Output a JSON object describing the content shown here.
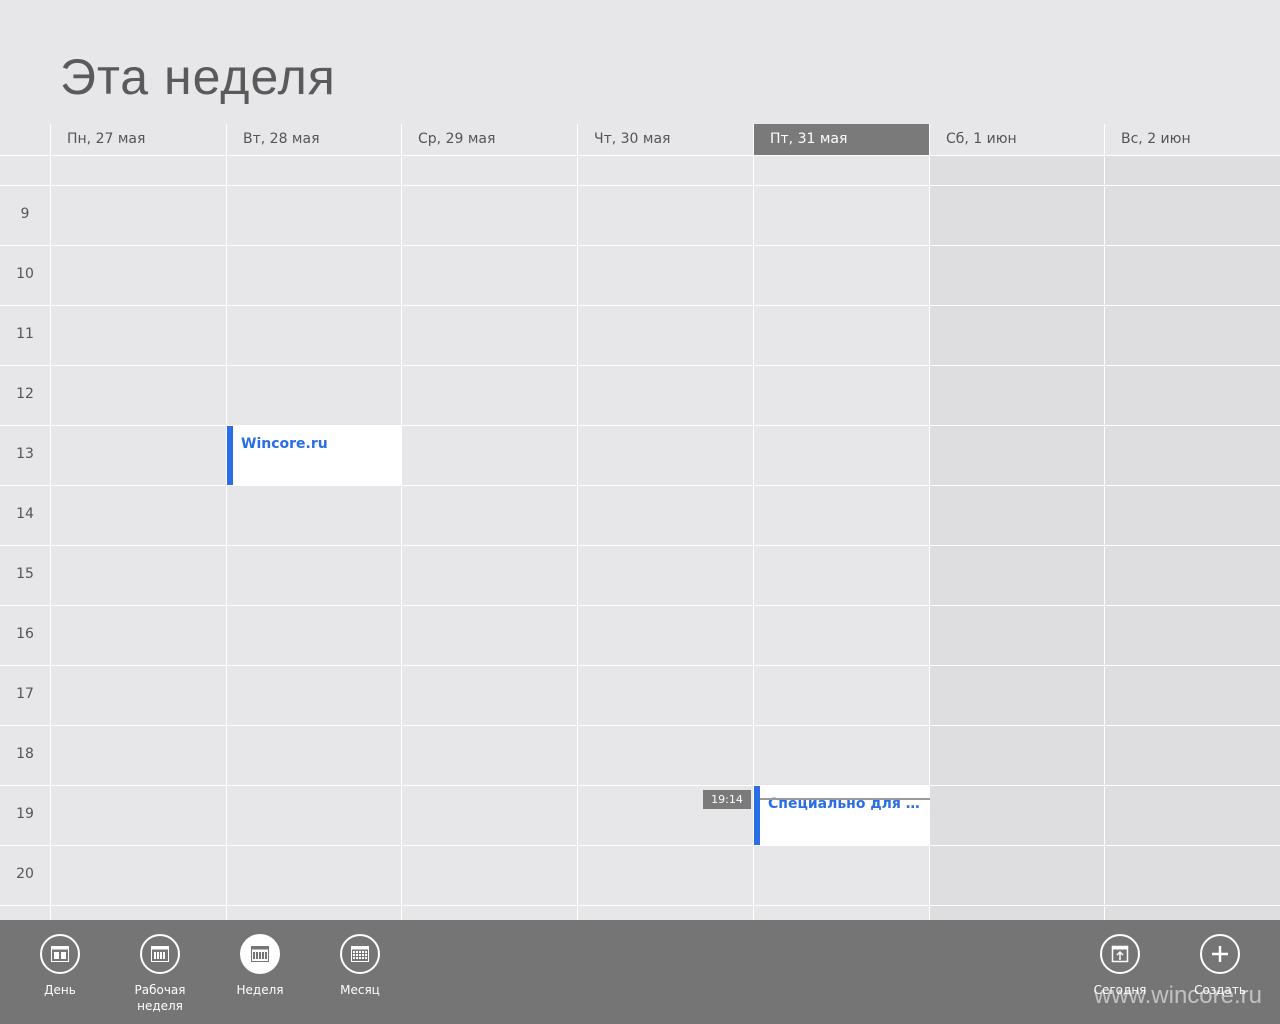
{
  "page": {
    "title": "Эта неделя"
  },
  "days": [
    {
      "label": "Пн, 27 мая",
      "today": false,
      "weekend": false
    },
    {
      "label": "Вт, 28 мая",
      "today": false,
      "weekend": false
    },
    {
      "label": "Ср, 29 мая",
      "today": false,
      "weekend": false
    },
    {
      "label": "Чт, 30 мая",
      "today": false,
      "weekend": false
    },
    {
      "label": "Пт, 31 мая",
      "today": true,
      "weekend": false
    },
    {
      "label": "Сб, 1 июн",
      "today": false,
      "weekend": true
    },
    {
      "label": "Вс, 2 июн",
      "today": false,
      "weekend": true
    }
  ],
  "hours": [
    "9",
    "10",
    "11",
    "12",
    "13",
    "14",
    "15",
    "16",
    "17",
    "18",
    "19",
    "20"
  ],
  "events": [
    {
      "title": "Wincore.ru",
      "day": "Вт, 28 мая",
      "start": "13",
      "end": "14"
    },
    {
      "title": "Специально для Wi...",
      "day": "Пт, 31 мая",
      "start": "19",
      "end": "20"
    }
  ],
  "now": {
    "time": "19:14"
  },
  "appbar": {
    "day": "День",
    "workweek": "Рабочая неделя",
    "week": "Неделя",
    "month": "Месяц",
    "today": "Сегодня",
    "create": "Создать"
  },
  "watermark": "www.wincore.ru",
  "colors": {
    "accent": "#2a6ee6",
    "today_header": "#7a7a7a",
    "appbar": "#757575"
  }
}
